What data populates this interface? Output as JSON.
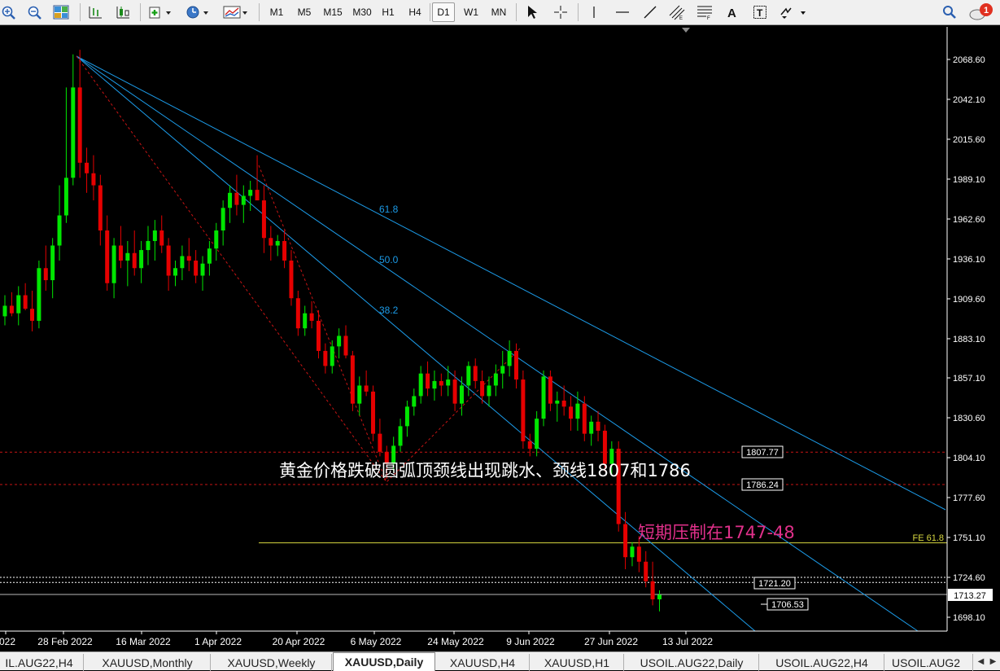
{
  "toolbar": {
    "timeframes": [
      "M1",
      "M5",
      "M15",
      "M30",
      "H1",
      "H4",
      "D1",
      "W1",
      "MN"
    ],
    "active_timeframe": "D1",
    "notification_count": "1"
  },
  "chart": {
    "colors": {
      "background": "#000000",
      "up": "#00e600",
      "down": "#e60000",
      "fib_line": "#1c9be8",
      "hline_red": "#c81414",
      "hline_white": "#ffffff",
      "fe_line": "#d8d840",
      "text": "#ffffff",
      "pink": "#e0308a"
    },
    "price_scale": [
      "2068.60",
      "2042.10",
      "2015.60",
      "1989.10",
      "1962.60",
      "1936.10",
      "1909.60",
      "1883.10",
      "1857.10",
      "1830.60",
      "1804.10",
      "1777.60",
      "1751.10",
      "1724.60",
      "1698.10"
    ],
    "date_axis": [
      "022",
      "28 Feb 2022",
      "16 Mar 2022",
      "1 Apr 2022",
      "20 Apr 2022",
      "6 May 2022",
      "24 May 2022",
      "9 Jun 2022",
      "27 Jun 2022",
      "13 Jul 2022"
    ],
    "fib_labels": [
      "61.8",
      "50.0",
      "38.2"
    ],
    "level_labels": {
      "l1807": "1807.77",
      "l1786": "1786.24",
      "l1721": "1721.20",
      "l1706": "1706.53",
      "l1713": "1713.27",
      "fe": "FE 61.8"
    },
    "annotation_main": "黄金价格跌破圆弧顶颈线出现跳水、颈线1807和1786",
    "annotation_short": "短期压制在1747-48"
  },
  "chart_data": {
    "type": "candlestick",
    "symbol": "XAUUSD",
    "timeframe": "Daily",
    "ylim": [
      1690,
      2090
    ],
    "levels": [
      1807.77,
      1786.24,
      1747.5,
      1724.6,
      1721.2,
      1713.27,
      1706.53
    ],
    "fibonacci_fan_levels": [
      61.8,
      50.0,
      38.2
    ],
    "fe_level": "FE 61.8",
    "candles": [
      [
        1898,
        1912,
        1892,
        1905
      ],
      [
        1905,
        1914,
        1898,
        1900
      ],
      [
        1900,
        1918,
        1892,
        1912
      ],
      [
        1912,
        1920,
        1902,
        1903
      ],
      [
        1903,
        1915,
        1888,
        1895
      ],
      [
        1895,
        1935,
        1890,
        1930
      ],
      [
        1930,
        1945,
        1915,
        1922
      ],
      [
        1922,
        1950,
        1910,
        1945
      ],
      [
        1945,
        1985,
        1935,
        1965
      ],
      [
        1965,
        2050,
        1960,
        1990
      ],
      [
        1990,
        2072,
        1985,
        2050
      ],
      [
        2050,
        2075,
        1990,
        2000
      ],
      [
        2000,
        2010,
        1980,
        1993
      ],
      [
        1993,
        2005,
        1975,
        1985
      ],
      [
        1985,
        1992,
        1945,
        1955
      ],
      [
        1955,
        1965,
        1915,
        1920
      ],
      [
        1920,
        1950,
        1910,
        1945
      ],
      [
        1945,
        1958,
        1930,
        1935
      ],
      [
        1935,
        1948,
        1918,
        1940
      ],
      [
        1940,
        1955,
        1925,
        1930
      ],
      [
        1930,
        1948,
        1920,
        1942
      ],
      [
        1942,
        1958,
        1932,
        1948
      ],
      [
        1948,
        1962,
        1935,
        1955
      ],
      [
        1955,
        1965,
        1940,
        1945
      ],
      [
        1945,
        1950,
        1915,
        1925
      ],
      [
        1925,
        1935,
        1918,
        1930
      ],
      [
        1930,
        1945,
        1922,
        1938
      ],
      [
        1938,
        1950,
        1928,
        1935
      ],
      [
        1935,
        1942,
        1920,
        1925
      ],
      [
        1925,
        1938,
        1915,
        1933
      ],
      [
        1933,
        1948,
        1925,
        1943
      ],
      [
        1943,
        1960,
        1935,
        1955
      ],
      [
        1955,
        1975,
        1945,
        1970
      ],
      [
        1970,
        1985,
        1960,
        1980
      ],
      [
        1980,
        1992,
        1965,
        1972
      ],
      [
        1972,
        1985,
        1960,
        1978
      ],
      [
        1978,
        1988,
        1968,
        1982
      ],
      [
        1982,
        2005,
        1975,
        1975
      ],
      [
        1975,
        1985,
        1940,
        1950
      ],
      [
        1950,
        1958,
        1935,
        1945
      ],
      [
        1945,
        1952,
        1938,
        1948
      ],
      [
        1948,
        1955,
        1930,
        1935
      ],
      [
        1935,
        1942,
        1905,
        1910
      ],
      [
        1910,
        1915,
        1885,
        1890
      ],
      [
        1890,
        1905,
        1885,
        1900
      ],
      [
        1900,
        1908,
        1890,
        1895
      ],
      [
        1895,
        1902,
        1870,
        1875
      ],
      [
        1875,
        1880,
        1860,
        1865
      ],
      [
        1865,
        1882,
        1860,
        1878
      ],
      [
        1878,
        1890,
        1870,
        1885
      ],
      [
        1885,
        1892,
        1870,
        1872
      ],
      [
        1872,
        1875,
        1835,
        1840
      ],
      [
        1840,
        1858,
        1832,
        1852
      ],
      [
        1852,
        1862,
        1845,
        1848
      ],
      [
        1848,
        1852,
        1815,
        1820
      ],
      [
        1820,
        1830,
        1805,
        1808
      ],
      [
        1808,
        1812,
        1790,
        1800
      ],
      [
        1800,
        1818,
        1795,
        1812
      ],
      [
        1812,
        1830,
        1808,
        1825
      ],
      [
        1825,
        1842,
        1818,
        1838
      ],
      [
        1838,
        1850,
        1832,
        1845
      ],
      [
        1845,
        1865,
        1840,
        1860
      ],
      [
        1860,
        1868,
        1845,
        1850
      ],
      [
        1850,
        1862,
        1842,
        1855
      ],
      [
        1855,
        1860,
        1845,
        1852
      ],
      [
        1852,
        1865,
        1845,
        1856
      ],
      [
        1856,
        1862,
        1835,
        1840
      ],
      [
        1840,
        1858,
        1832,
        1852
      ],
      [
        1852,
        1868,
        1845,
        1865
      ],
      [
        1865,
        1870,
        1850,
        1855
      ],
      [
        1855,
        1862,
        1840,
        1845
      ],
      [
        1845,
        1858,
        1838,
        1852
      ],
      [
        1852,
        1866,
        1845,
        1860
      ],
      [
        1860,
        1875,
        1850,
        1865
      ],
      [
        1865,
        1882,
        1858,
        1875
      ],
      [
        1875,
        1880,
        1850,
        1856
      ],
      [
        1856,
        1862,
        1810,
        1815
      ],
      [
        1815,
        1820,
        1805,
        1810
      ],
      [
        1810,
        1835,
        1805,
        1830
      ],
      [
        1830,
        1862,
        1825,
        1858
      ],
      [
        1858,
        1862,
        1835,
        1840
      ],
      [
        1840,
        1848,
        1828,
        1842
      ],
      [
        1842,
        1852,
        1832,
        1838
      ],
      [
        1838,
        1845,
        1822,
        1830
      ],
      [
        1830,
        1848,
        1822,
        1840
      ],
      [
        1840,
        1845,
        1815,
        1820
      ],
      [
        1820,
        1832,
        1812,
        1828
      ],
      [
        1828,
        1835,
        1815,
        1822
      ],
      [
        1822,
        1826,
        1795,
        1800
      ],
      [
        1800,
        1815,
        1792,
        1810
      ],
      [
        1810,
        1815,
        1755,
        1760
      ],
      [
        1760,
        1768,
        1730,
        1738
      ],
      [
        1738,
        1748,
        1732,
        1745
      ],
      [
        1745,
        1752,
        1728,
        1735
      ],
      [
        1735,
        1742,
        1718,
        1722
      ],
      [
        1722,
        1735,
        1706,
        1710
      ],
      [
        1710,
        1716,
        1702,
        1713
      ]
    ]
  }
}
